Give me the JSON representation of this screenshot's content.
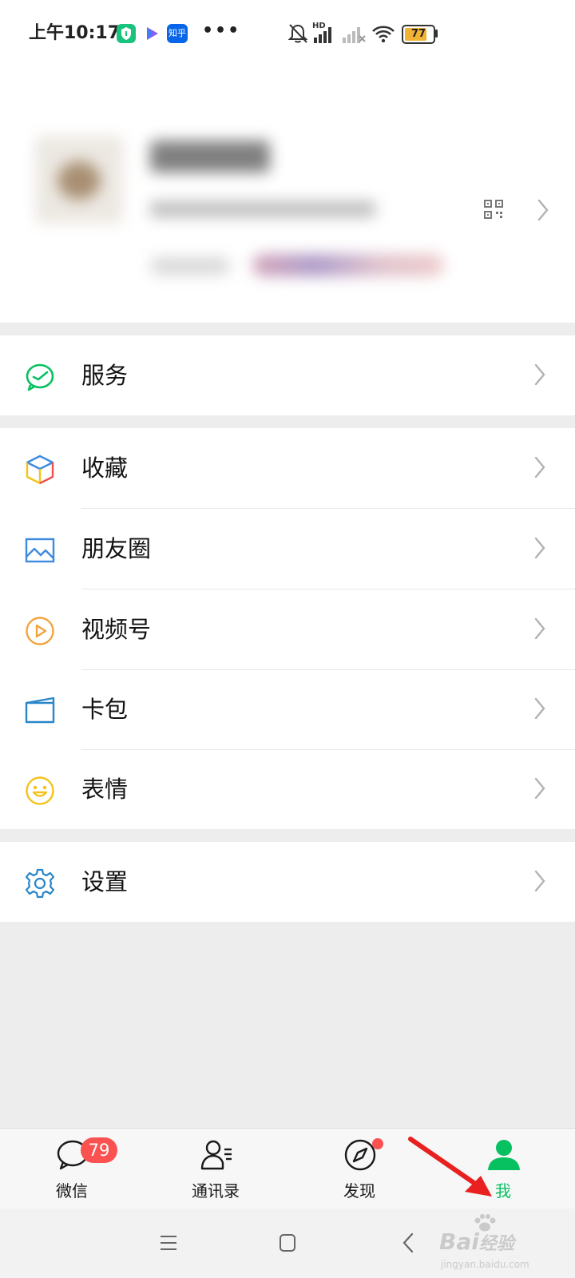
{
  "status_bar": {
    "time": "上午10:17",
    "apps": [
      "shield-app-icon",
      "play-app-icon",
      "zhihu-app-icon"
    ],
    "zhihu_label": "知乎",
    "more": "•••",
    "hd": "HD",
    "battery": "77"
  },
  "menu": {
    "services": "服务",
    "favorites": "收藏",
    "moments": "朋友圈",
    "channels": "视频号",
    "cards": "卡包",
    "stickers": "表情",
    "settings": "设置"
  },
  "tabs": {
    "chats": "微信",
    "chats_badge": "79",
    "contacts": "通讯录",
    "discover": "发现",
    "me": "我"
  },
  "colors": {
    "brand_green": "#07c160",
    "badge_red": "#fa5151",
    "annotation_arrow": "#e8201f"
  },
  "watermark": {
    "brand": "Bai",
    "brand_cn": "经验",
    "url": "jingyan.baidu.com"
  }
}
